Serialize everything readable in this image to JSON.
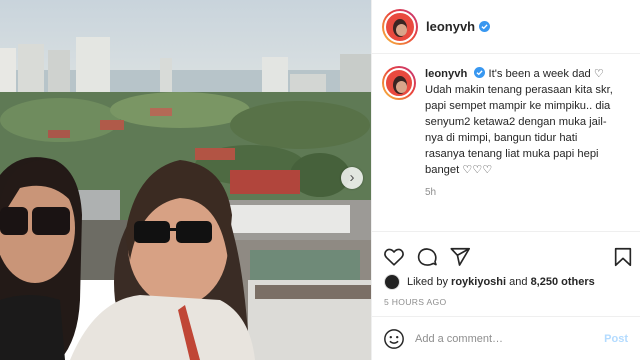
{
  "post": {
    "username": "leonyvh",
    "verified": true,
    "caption_lines": [
      "It's been a week dad ♡",
      "Udah makin tenang perasaan kita skr,",
      "papi sempet mampir ke mimpiku.. dia",
      "senyum2 ketawa2 dengan muka jail-",
      "nya di mimpi, bangun tidur hati",
      "rasanya tenang liat muka papi hepi",
      "banget ♡♡♡"
    ],
    "caption_time": "5h",
    "liked_prefix": "Liked by ",
    "liked_user": "roykiyoshi",
    "liked_and": " and ",
    "liked_count": "8,250 others",
    "time_ago": "5 HOURS AGO"
  },
  "comment": {
    "placeholder": "Add a comment…",
    "post_label": "Post"
  },
  "icons": {
    "like": "heart-icon",
    "comment": "comment-icon",
    "share": "paper-plane-icon",
    "save": "bookmark-icon",
    "emoji": "emoji-icon",
    "verified": "verified-badge-icon",
    "next": "chevron-right-icon"
  },
  "colors": {
    "accent_blue": "#3897f0",
    "post_disabled": "#b3dbff",
    "avatar_red": "#e94a3f",
    "muted_text": "#8e8e8e"
  }
}
